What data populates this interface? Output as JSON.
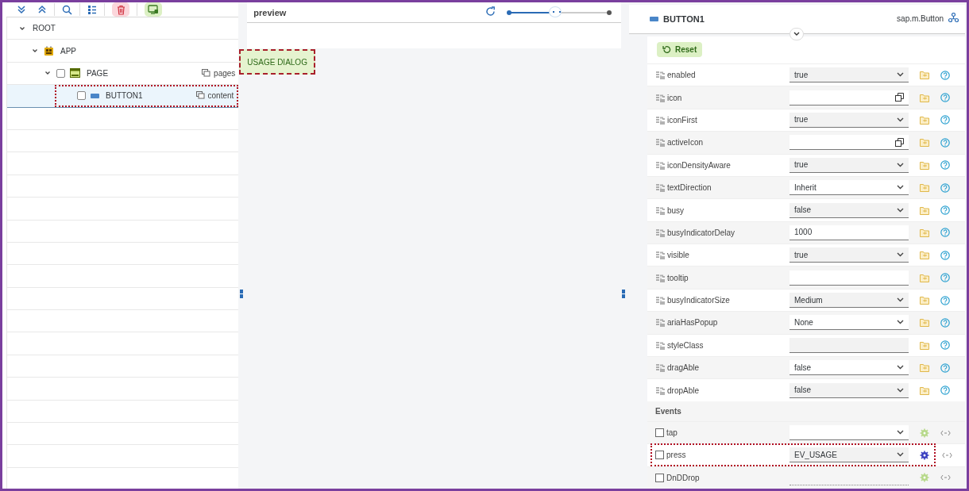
{
  "tree": [
    {
      "label": "ROOT",
      "expanded": true,
      "selected": false,
      "highlighted": false,
      "children": [
        {
          "label": "APP",
          "kind": "app",
          "expanded": true,
          "selected": false,
          "highlighted": false,
          "children": [
            {
              "label": "PAGE",
              "kind": "page",
              "expanded": true,
              "checked": false,
              "selected": false,
              "highlighted": false,
              "aggregation": "pages",
              "children": [
                {
                  "label": "BUTTON1",
                  "kind": "button",
                  "checked": false,
                  "selected": true,
                  "highlighted": true,
                  "aggregation": "content"
                }
              ]
            }
          ]
        }
      ]
    }
  ],
  "preview": {
    "title": "preview",
    "zoom": {
      "level": 0.46
    },
    "button": {
      "label": "USAGE DIALOG",
      "highlighted": true
    }
  },
  "inspector": {
    "title": "BUTTON1",
    "class_name": "sap.m.Button",
    "reset": "Reset",
    "properties": [
      {
        "name": "enabled",
        "kind": "select",
        "value": "true"
      },
      {
        "name": "icon",
        "kind": "valuehelp"
      },
      {
        "name": "iconFirst",
        "kind": "select",
        "value": "true"
      },
      {
        "name": "activeIcon",
        "kind": "valuehelp"
      },
      {
        "name": "iconDensityAware",
        "kind": "select",
        "value": "true"
      },
      {
        "name": "textDirection",
        "kind": "select",
        "value": "Inherit"
      },
      {
        "name": "busy",
        "kind": "select",
        "value": "false"
      },
      {
        "name": "busyIndicatorDelay",
        "kind": "input",
        "value": "1000"
      },
      {
        "name": "visible",
        "kind": "select",
        "value": "true"
      },
      {
        "name": "tooltip",
        "kind": "input"
      },
      {
        "name": "busyIndicatorSize",
        "kind": "select",
        "value": "Medium"
      },
      {
        "name": "ariaHasPopup",
        "kind": "select",
        "value": "None"
      },
      {
        "name": "styleClass",
        "kind": "input"
      },
      {
        "name": "dragAble",
        "kind": "select",
        "value": "false"
      },
      {
        "name": "dropAble",
        "kind": "select",
        "value": "false"
      }
    ],
    "events_title": "Events",
    "events": [
      {
        "name": "tap",
        "checked": false,
        "kind": "select",
        "handler_active": false,
        "highlighted": false
      },
      {
        "name": "press",
        "checked": false,
        "kind": "select",
        "value": "EV_USAGE",
        "handler_active": true,
        "highlighted": true
      },
      {
        "name": "DnDDrop",
        "checked": false,
        "kind": "plain",
        "handler_active": false,
        "highlighted": false
      }
    ]
  }
}
